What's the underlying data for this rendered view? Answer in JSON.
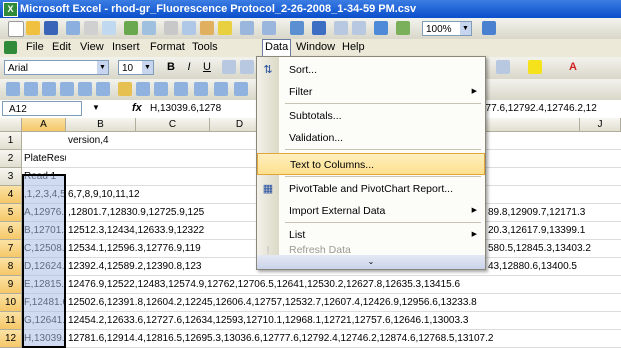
{
  "window": {
    "title": "Microsoft Excel - rhod-gr_Fluorescence Protocol_2-26-2008_1-34-59 PM.csv"
  },
  "standard_toolbar": {
    "zoom": "100%"
  },
  "menubar": {
    "items": [
      "File",
      "Edit",
      "View",
      "Insert",
      "Format",
      "Tools",
      "Data",
      "Window",
      "Help"
    ],
    "active": "Data"
  },
  "formatting_toolbar": {
    "font": "Arial",
    "size": "10"
  },
  "formula_bar": {
    "name_box": "A12",
    "fx": "fx",
    "content_left": "H,13039.6,1278",
    "content_right": "777.6,12792.4,12746.2,12"
  },
  "columns": [
    "A",
    "B",
    "C",
    "D",
    "J"
  ],
  "rows": [
    {
      "num": "1",
      "a": "",
      "rest": "version,4"
    },
    {
      "num": "2",
      "a": "PlateResults",
      "rest": ""
    },
    {
      "num": "3",
      "a": "Read 1",
      "rest": ""
    },
    {
      "num": "4",
      "a": ",1,2,3,4,5",
      "rest": "6,7,8,9,10,11,12"
    },
    {
      "num": "5",
      "a": "A,12976.",
      "rest": ",12801.7,12830.9,12725.9,125",
      "right": "89.8,12909.7,12171.3"
    },
    {
      "num": "6",
      "a": "B,12701.9",
      "rest": "12512.3,12434,12633.9,12322",
      "right": "20.3,12617.9,13399.1"
    },
    {
      "num": "7",
      "a": "C,12508.",
      "rest": "12534.1,12596.3,12776.9,119",
      "right": "580.5,12845.3,13403.2"
    },
    {
      "num": "8",
      "a": "D,12624.",
      "rest": "12392.4,12589.2,12390.8,123",
      "right": "43,12880.6,13400.5"
    },
    {
      "num": "9",
      "a": "E,12815.",
      "rest": "12476.9,12522,12483,12574.9,12762,12706.5,12641,12530.2,12627.8,12635.3,13415.6"
    },
    {
      "num": "10",
      "a": "F,12481.6",
      "rest": "12502.6,12391.8,12604.2,12245,12606.4,12757,12532.7,12607.4,12426.9,12956.6,13233.8"
    },
    {
      "num": "11",
      "a": "G,12641.",
      "rest": "12454.2,12633.6,12727.6,12634,12593,12710.1,12968.1,12721,12757.6,12646.1,13003.3"
    },
    {
      "num": "12",
      "a": "H,13039.6",
      "rest": "12781.6,12914.4,12816.5,12695.3,13036.6,12777.6,12792.4,12746.2,12874.6,12768.5,13107.2"
    }
  ],
  "data_menu": {
    "items": [
      {
        "label": "Sort...",
        "icon": "sort-icon",
        "submenu": false,
        "disabled": false
      },
      {
        "label": "Filter",
        "icon": "",
        "submenu": true,
        "disabled": false
      },
      {
        "label": "Subtotals...",
        "icon": "",
        "submenu": false,
        "disabled": false
      },
      {
        "label": "Validation...",
        "icon": "",
        "submenu": false,
        "disabled": false
      },
      {
        "label": "Text to Columns...",
        "icon": "",
        "submenu": false,
        "disabled": false,
        "highlighted": true
      },
      {
        "label": "PivotTable and PivotChart Report...",
        "icon": "pivot-icon",
        "submenu": false,
        "disabled": false
      },
      {
        "label": "Import External Data",
        "icon": "",
        "submenu": true,
        "disabled": false
      },
      {
        "label": "List",
        "icon": "",
        "submenu": true,
        "disabled": false
      },
      {
        "label": "Refresh Data",
        "icon": "refresh-icon",
        "submenu": false,
        "disabled": true
      }
    ]
  },
  "colors": {
    "title_bar": "#0a4ecb",
    "highlight": "#fde08e",
    "selection": "#aabee6"
  }
}
